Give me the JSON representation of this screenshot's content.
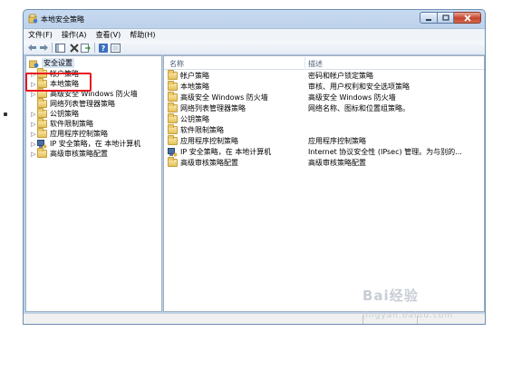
{
  "window": {
    "title": "本地安全策略"
  },
  "menu": {
    "items": [
      {
        "label": "文件(F)"
      },
      {
        "label": "操作(A)"
      },
      {
        "label": "查看(V)"
      },
      {
        "label": "帮助(H)"
      }
    ]
  },
  "toolbar": {
    "icons": [
      "back-arrow-icon",
      "forward-arrow-icon",
      "console-tree-icon",
      "delete-icon",
      "export-list-icon",
      "help-icon",
      "properties-icon"
    ]
  },
  "tree": {
    "root": "安全设置",
    "items": [
      {
        "label": "帐户策略"
      },
      {
        "label": "本地策略"
      },
      {
        "label": "高级安全 Windows 防火墙"
      },
      {
        "label": "网络列表管理器策略"
      },
      {
        "label": "公钥策略"
      },
      {
        "label": "软件限制策略"
      },
      {
        "label": "应用程序控制策略"
      },
      {
        "label": "IP 安全策略，在 本地计算机"
      },
      {
        "label": "高级审核策略配置"
      }
    ]
  },
  "list": {
    "col_name": "名称",
    "col_desc": "描述",
    "rows": [
      {
        "name": "帐户策略",
        "desc": "密码和帐户锁定策略"
      },
      {
        "name": "本地策略",
        "desc": "审核、用户权利和安全选项策略"
      },
      {
        "name": "高级安全 Windows 防火墙",
        "desc": "高级安全 Windows 防火墙"
      },
      {
        "name": "网络列表管理器策略",
        "desc": "网络名称、图标和位置组策略。"
      },
      {
        "name": "公钥策略",
        "desc": ""
      },
      {
        "name": "软件限制策略",
        "desc": ""
      },
      {
        "name": "应用程序控制策略",
        "desc": "应用程序控制策略"
      },
      {
        "name": "IP 安全策略，在 本地计算机",
        "desc": "Internet 协议安全性 (IPsec) 管理。为与别的..."
      },
      {
        "name": "高级审核策略配置",
        "desc": "高级审核策略配置"
      }
    ]
  },
  "watermark": {
    "text": "Bai",
    "suffix": "经验",
    "sub": "jingyan.baidu.com"
  },
  "colors": {
    "highlight": "#e8141c",
    "accent": "#6d8fb3"
  }
}
